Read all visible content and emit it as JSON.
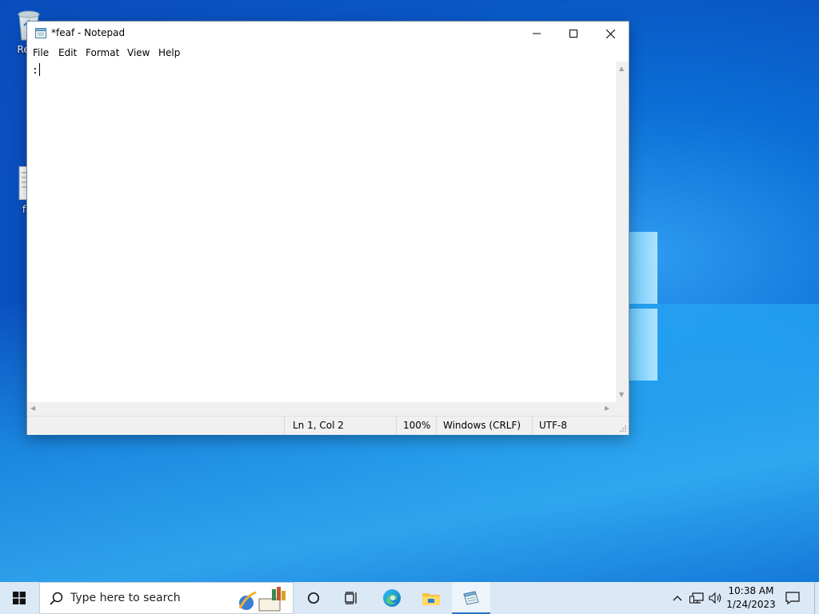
{
  "desktop": {
    "icons": [
      {
        "label": "Recy"
      },
      {
        "label": "f"
      }
    ]
  },
  "window": {
    "title": "*feaf - Notepad",
    "minimize_glyph": "—",
    "maximize_glyph": "☐",
    "close_glyph": "✕",
    "menu": [
      "File",
      "Edit",
      "Format",
      "View",
      "Help"
    ],
    "editor_text": ":",
    "status": {
      "position": "Ln 1, Col 2",
      "zoom": "100%",
      "line_ending": "Windows (CRLF)",
      "encoding": "UTF-8"
    }
  },
  "taskbar": {
    "search_placeholder": "Type here to search",
    "clock_time": "10:38 AM",
    "clock_date": "1/24/2023"
  },
  "colors": {
    "accent": "#2a73c9",
    "taskbar": "#dbe8f6"
  }
}
